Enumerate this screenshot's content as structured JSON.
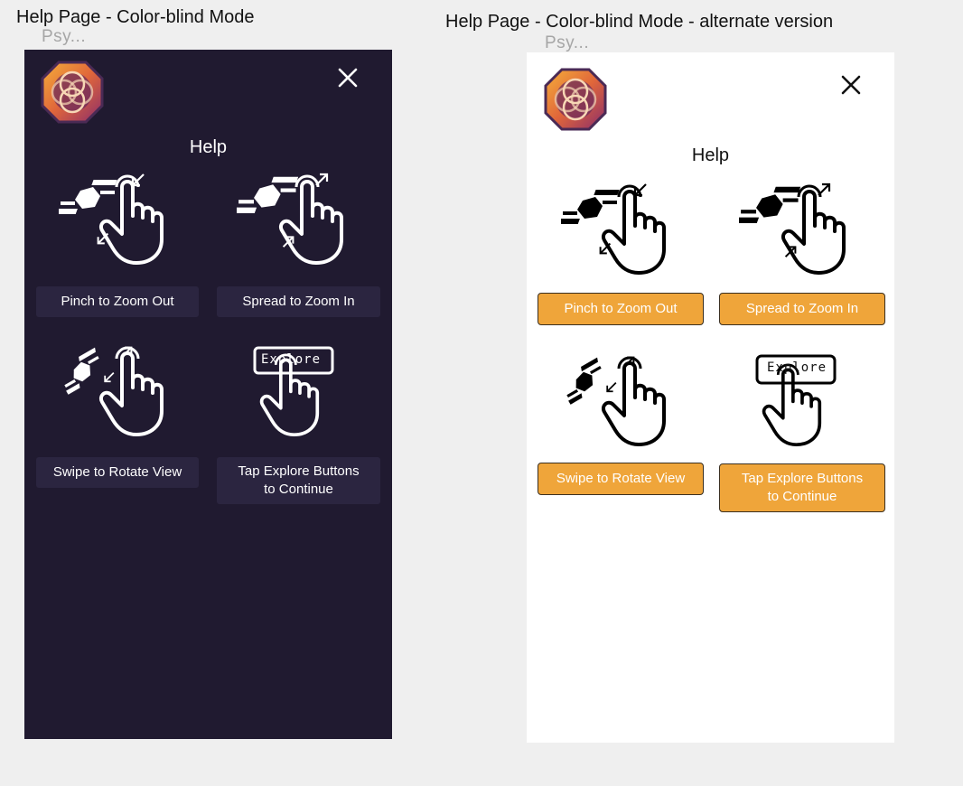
{
  "frames": [
    {
      "title": "Help Page - Color-blind Mode",
      "subtitle": "Psy...",
      "theme": "dark",
      "background": "#201a30",
      "logo_icon": "app-logo-icon",
      "close_icon": "close-icon",
      "heading": "Help",
      "gestures": [
        {
          "label": "Pinch to Zoom Out",
          "icon": "pinch-gesture-icon"
        },
        {
          "label": "Spread to Zoom In",
          "icon": "spread-gesture-icon"
        },
        {
          "label": "Swipe to Rotate View",
          "icon": "swipe-gesture-icon"
        },
        {
          "label": "Tap Explore Buttons\nto Continue",
          "icon": "tap-explore-icon",
          "icon_text": "Explore"
        }
      ]
    },
    {
      "title": "Help Page - Color-blind Mode - alternate version",
      "subtitle": "Psy...",
      "theme": "light",
      "background": "#ffffff",
      "accent": "#efa53a",
      "logo_icon": "app-logo-icon",
      "close_icon": "close-icon",
      "heading": "Help",
      "gestures": [
        {
          "label": "Pinch to Zoom Out",
          "icon": "pinch-gesture-icon"
        },
        {
          "label": "Spread to Zoom In",
          "icon": "spread-gesture-icon"
        },
        {
          "label": "Swipe to Rotate View",
          "icon": "swipe-gesture-icon"
        },
        {
          "label": "Tap Explore Buttons\nto Continue",
          "icon": "tap-explore-icon",
          "icon_text": "Explore"
        }
      ]
    }
  ]
}
